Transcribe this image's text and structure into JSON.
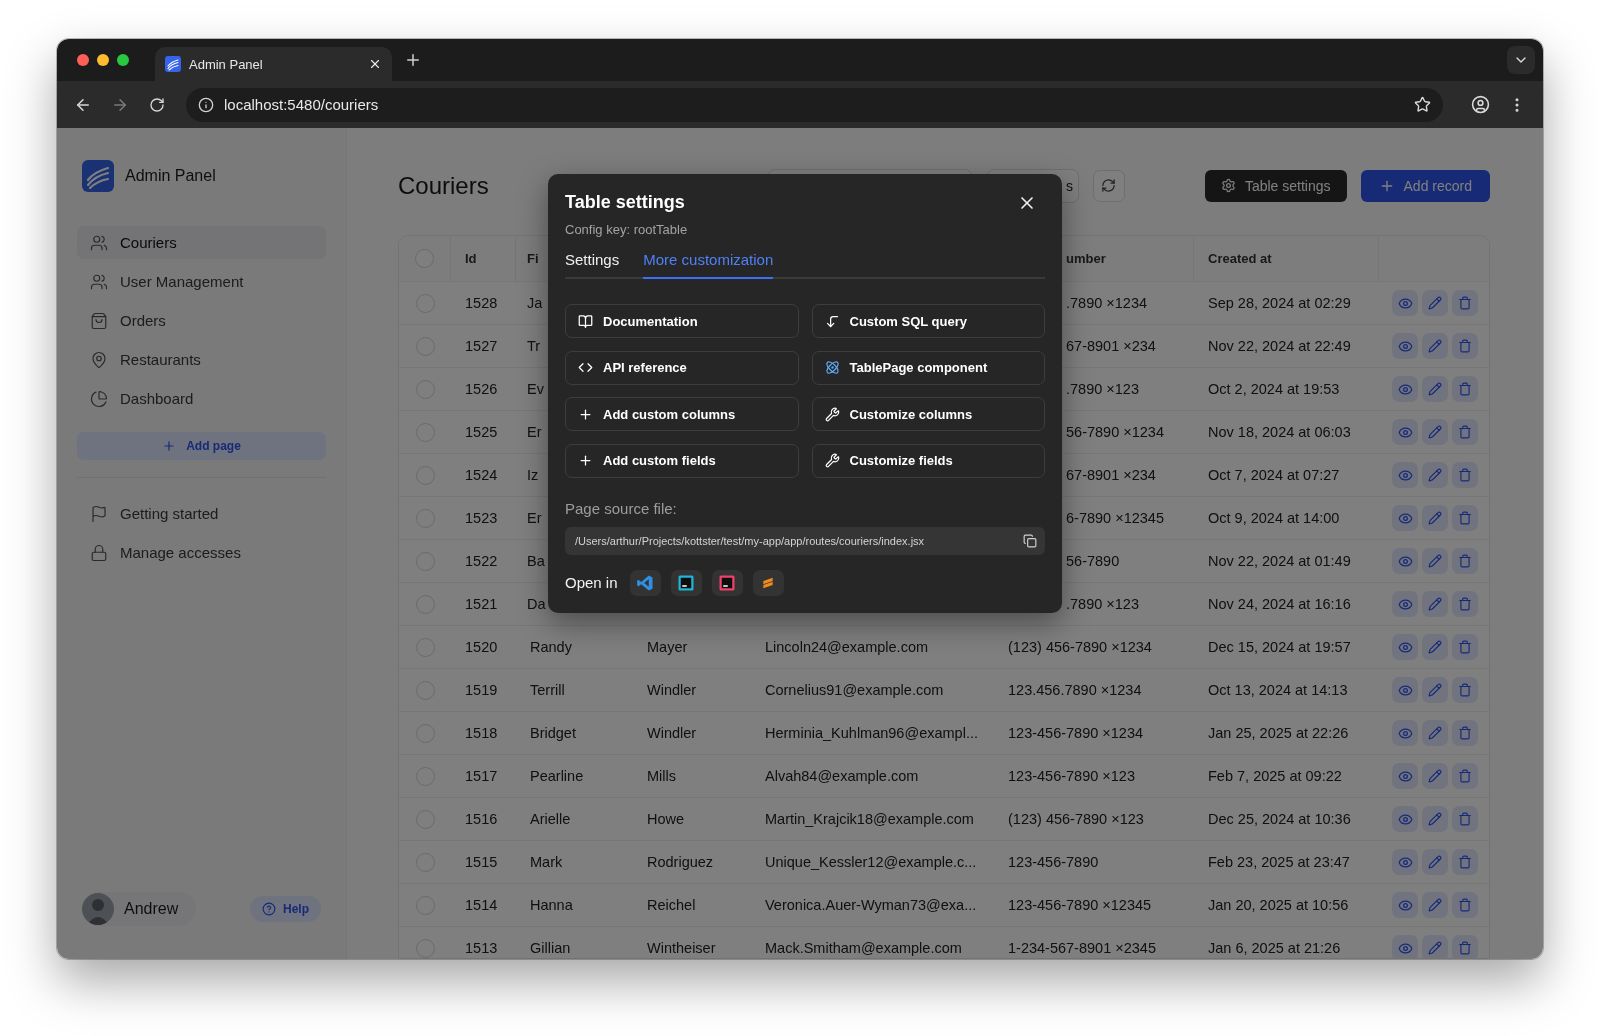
{
  "browser": {
    "tab_title": "Admin Panel",
    "url": "localhost:5480/couriers"
  },
  "sidebar": {
    "app_name": "Admin Panel",
    "nav": [
      {
        "label": "Couriers",
        "selected": true
      },
      {
        "label": "User Management",
        "selected": false
      },
      {
        "label": "Orders",
        "selected": false
      },
      {
        "label": "Restaurants",
        "selected": false
      },
      {
        "label": "Dashboard",
        "selected": false
      }
    ],
    "add_page": "Add page",
    "secondary_nav": [
      {
        "label": "Getting started",
        "selected": false
      },
      {
        "label": "Manage accesses",
        "selected": false
      }
    ],
    "user": {
      "name": "Andrew"
    },
    "help": "Help"
  },
  "page": {
    "title": "Couriers",
    "toolbar_button": "s",
    "table_settings_button": "Table settings",
    "add_record_button": "Add record"
  },
  "table": {
    "all_selected": false,
    "header": {
      "id": "Id",
      "first_name": "Fi",
      "phone": "umber",
      "created_at": "Created at"
    },
    "rows": [
      {
        "selected": false,
        "id": "1528",
        "first_name": "Ja",
        "phone": ".7890 ×1234",
        "created_at": "Sep 28, 2024 at 02:29"
      },
      {
        "selected": false,
        "id": "1527",
        "first_name": "Tr",
        "phone": "67-8901 ×234",
        "created_at": "Nov 22, 2024 at 22:49"
      },
      {
        "selected": false,
        "id": "1526",
        "first_name": "Ev",
        "phone": ".7890 ×123",
        "created_at": "Oct 2, 2024 at 19:53"
      },
      {
        "selected": false,
        "id": "1525",
        "first_name": "Er",
        "phone": "56-7890 ×1234",
        "created_at": "Nov 18, 2024 at 06:03"
      },
      {
        "selected": false,
        "id": "1524",
        "first_name": "Iz",
        "phone": "67-8901 ×234",
        "created_at": "Oct 7, 2024 at 07:27"
      },
      {
        "selected": false,
        "id": "1523",
        "first_name": "Er",
        "phone": "6-7890 ×12345",
        "created_at": "Oct 9, 2024 at 14:00"
      },
      {
        "selected": false,
        "id": "1522",
        "first_name": "Ba",
        "phone": "56-7890",
        "created_at": "Nov 22, 2024 at 01:49"
      },
      {
        "selected": false,
        "id": "1521",
        "first_name": "Da",
        "phone": ".7890 ×123",
        "created_at": "Nov 24, 2024 at 16:16"
      },
      {
        "selected": false,
        "id": "1520",
        "first_name": "Randy",
        "last_name": "Mayer",
        "email": "Lincoln24@example.com",
        "phone": "(123) 456-7890 ×1234",
        "created_at": "Dec 15, 2024 at 19:57"
      },
      {
        "selected": false,
        "id": "1519",
        "first_name": "Terrill",
        "last_name": "Windler",
        "email": "Cornelius91@example.com",
        "phone": "123.456.7890 ×1234",
        "created_at": "Oct 13, 2024 at 14:13"
      },
      {
        "selected": false,
        "id": "1518",
        "first_name": "Bridget",
        "last_name": "Windler",
        "email": "Herminia_Kuhlman96@exampl...",
        "phone": "123-456-7890 ×1234",
        "created_at": "Jan 25, 2025 at 22:26"
      },
      {
        "selected": false,
        "id": "1517",
        "first_name": "Pearline",
        "last_name": "Mills",
        "email": "Alvah84@example.com",
        "phone": "123-456-7890 ×123",
        "created_at": "Feb 7, 2025 at 09:22"
      },
      {
        "selected": false,
        "id": "1516",
        "first_name": "Arielle",
        "last_name": "Howe",
        "email": "Martin_Krajcik18@example.com",
        "phone": "(123) 456-7890 ×123",
        "created_at": "Dec 25, 2024 at 10:36"
      },
      {
        "selected": false,
        "id": "1515",
        "first_name": "Mark",
        "last_name": "Rodriguez",
        "email": "Unique_Kessler12@example.c...",
        "phone": "123-456-7890",
        "created_at": "Feb 23, 2025 at 23:47"
      },
      {
        "selected": false,
        "id": "1514",
        "first_name": "Hanna",
        "last_name": "Reichel",
        "email": "Veronica.Auer-Wyman73@exa...",
        "phone": "123-456-7890 ×12345",
        "created_at": "Jan 20, 2025 at 10:56"
      },
      {
        "selected": false,
        "id": "1513",
        "first_name": "Gillian",
        "last_name": "Wintheiser",
        "email": "Mack.Smitham@example.com",
        "phone": "1-234-567-8901 ×2345",
        "created_at": "Jan 6, 2025 at 21:26"
      }
    ]
  },
  "dialog": {
    "title": "Table settings",
    "config_key": "Config key: rootTable",
    "tabs": [
      {
        "label": "Settings",
        "selected": false
      },
      {
        "label": "More customization",
        "selected": true
      }
    ],
    "actions": [
      "Documentation",
      "Custom SQL query",
      "API reference",
      "TablePage component",
      "Add custom columns",
      "Customize columns",
      "Add custom fields",
      "Customize fields"
    ],
    "source_label": "Page source file:",
    "source_path": "/Users/arthur/Projects/kottster/test/my-app/app/routes/couriers/index.jsx",
    "open_in_label": "Open in"
  }
}
